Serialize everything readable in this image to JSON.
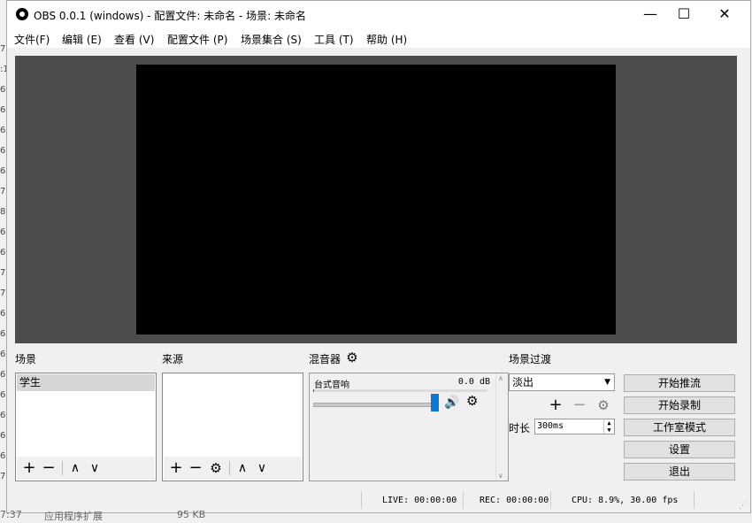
{
  "window": {
    "title": "OBS 0.0.1 (windows) - 配置文件: 未命名 - 场景: 未命名",
    "minimize": "—",
    "maximize": "☐",
    "close": "✕"
  },
  "menu": [
    "文件(F)",
    "编辑 (E)",
    "查看 (V)",
    "配置文件 (P)",
    "场景集合 (S)",
    "工具 (T)",
    "帮助 (H)"
  ],
  "scenes": {
    "title": "场景",
    "items": [
      "学生"
    ]
  },
  "sources": {
    "title": "来源",
    "items": []
  },
  "mixer": {
    "title": "混音器",
    "channel": "台式音响",
    "level": "0.0 dB",
    "volume_fraction": 0.98
  },
  "transitions": {
    "title": "场景过渡",
    "selected": "淡出",
    "duration_label": "时长",
    "duration_value": "300ms"
  },
  "controls": {
    "start_streaming": "开始推流",
    "start_recording": "开始录制",
    "studio_mode": "工作室模式",
    "settings": "设置",
    "exit": "退出"
  },
  "status": {
    "live": "LIVE: 00:00:00",
    "rec": "REC: 00:00:00",
    "cpu": "CPU: 8.9%, 30.00 fps"
  },
  "background": {
    "left_digits": [
      "7",
      ":1",
      "6",
      "6",
      "6",
      "6",
      "6",
      "7",
      "8",
      "6",
      "6",
      "7",
      "7",
      "6",
      "6",
      "6",
      "6",
      "6",
      "6",
      "6",
      "6",
      "7"
    ],
    "bottom_time": "7:37",
    "bottom_name": "应用程序扩展",
    "bottom_size": "95 KB"
  },
  "icons": {
    "add": "plus-icon",
    "remove": "minus-icon",
    "up": "chevron-up-icon",
    "down": "chevron-down-icon",
    "gear": "gear-icon",
    "speaker": "speaker-icon"
  }
}
